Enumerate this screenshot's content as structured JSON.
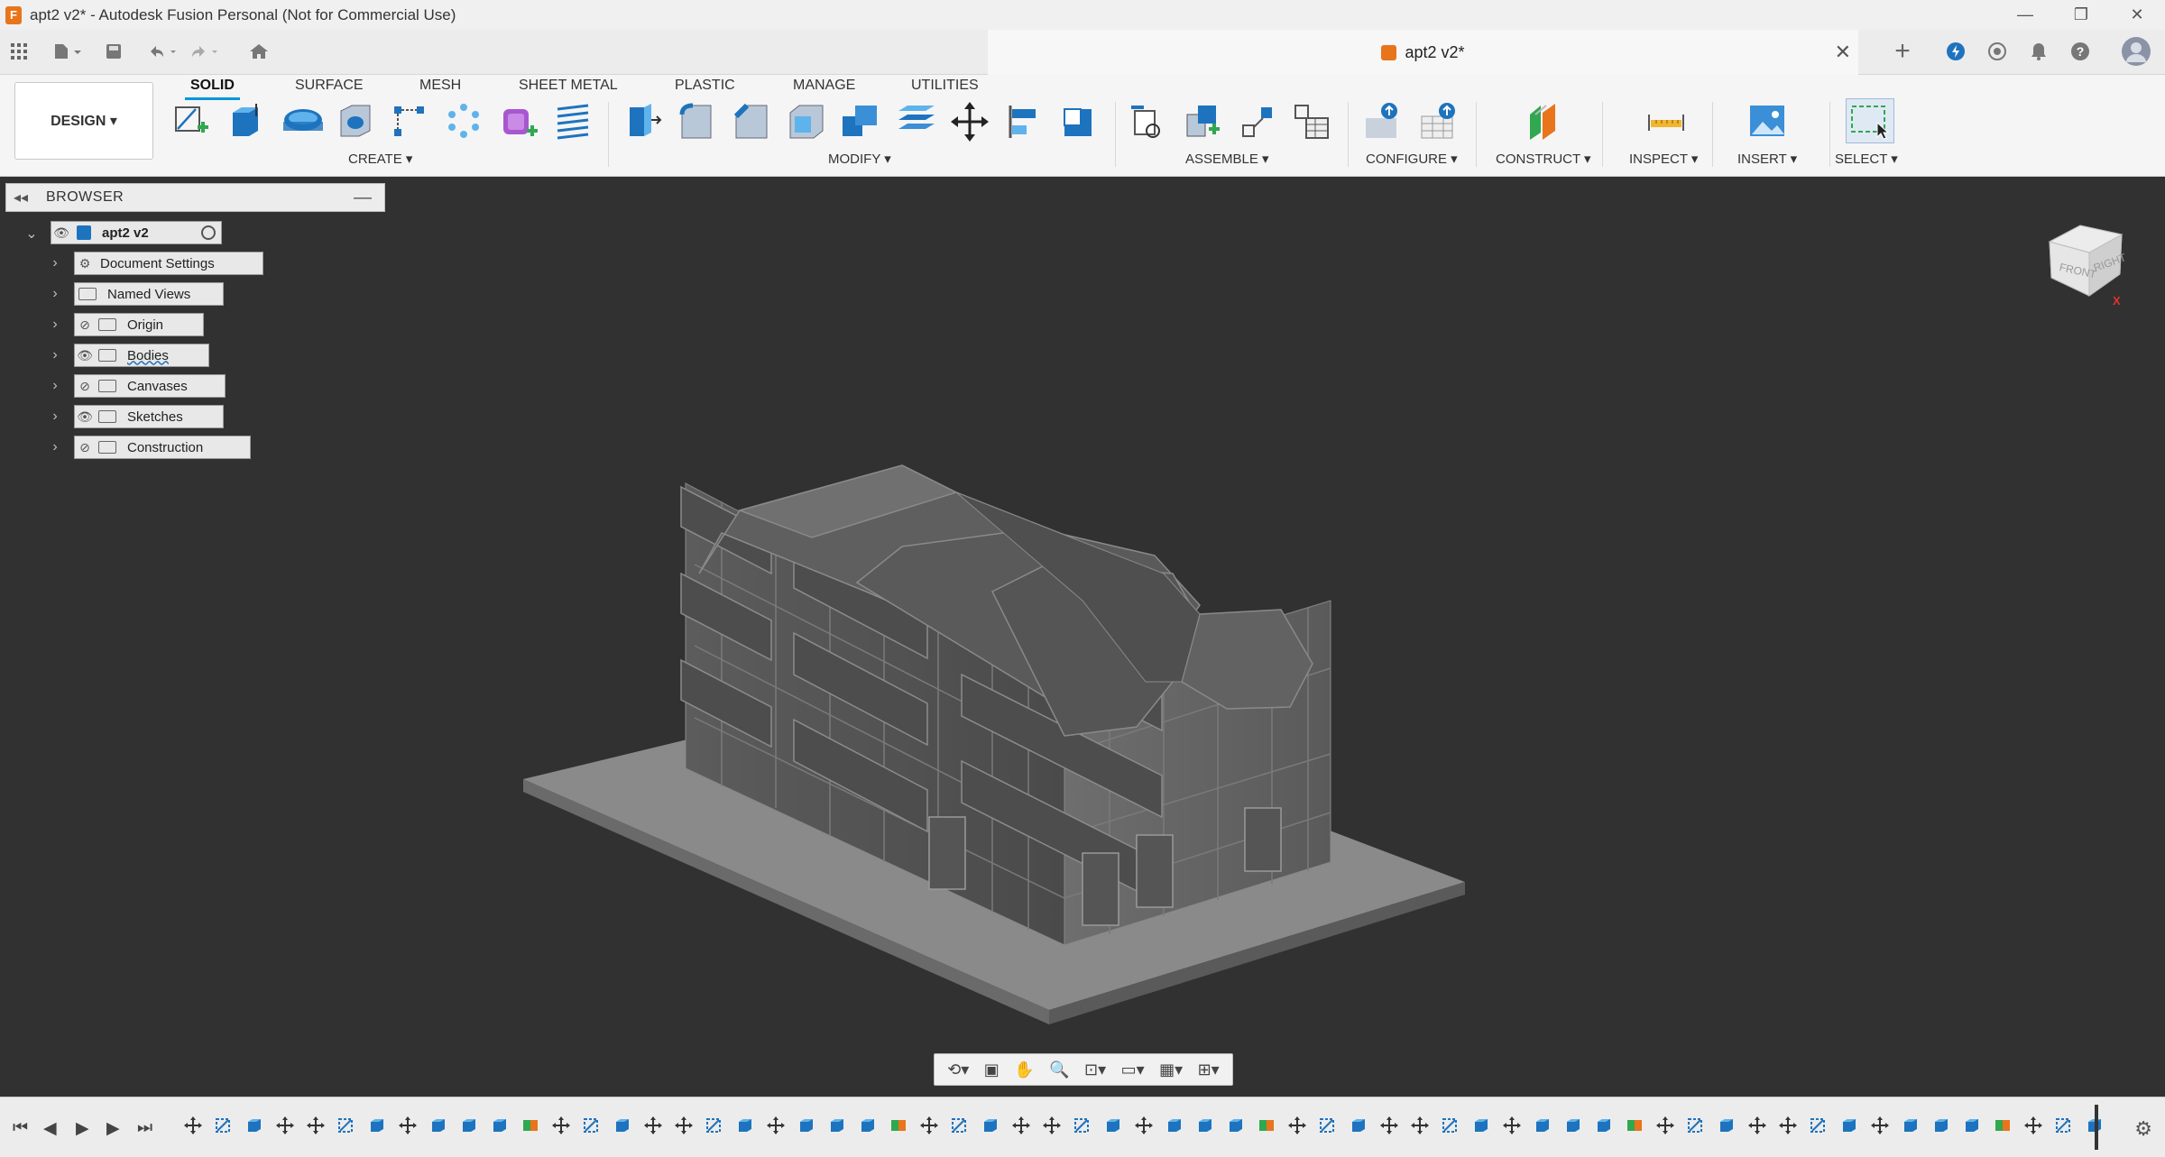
{
  "window": {
    "title": "apt2 v2* - Autodesk Fusion Personal (Not for Commercial Use)",
    "app_icon_letter": "F",
    "controls": {
      "minimize": "—",
      "restore": "❐",
      "close": "✕"
    }
  },
  "tabbar": {
    "document_tab": "apt2 v2*",
    "close_glyph": "✕",
    "new_tab_glyph": "+",
    "icons": [
      "apps-grid-icon",
      "file-icon",
      "save-icon",
      "undo-icon",
      "redo-icon",
      "home-icon",
      "extensions-icon",
      "job-status-icon",
      "notifications-icon",
      "help-icon",
      "user-avatar-icon"
    ]
  },
  "ribbon": {
    "workspace_button": "DESIGN ▾",
    "tabs": [
      {
        "label": "SOLID",
        "active": true
      },
      {
        "label": "SURFACE",
        "active": false
      },
      {
        "label": "MESH",
        "active": false
      },
      {
        "label": "SHEET METAL",
        "active": false
      },
      {
        "label": "PLASTIC",
        "active": false
      },
      {
        "label": "MANAGE",
        "active": false
      },
      {
        "label": "UTILITIES",
        "active": false
      }
    ],
    "groups": [
      {
        "label": "CREATE ▾"
      },
      {
        "label": "MODIFY ▾"
      },
      {
        "label": "ASSEMBLE ▾"
      },
      {
        "label": "CONFIGURE ▾"
      },
      {
        "label": "CONSTRUCT ▾"
      },
      {
        "label": "INSPECT ▾"
      },
      {
        "label": "INSERT ▾"
      },
      {
        "label": "SELECT ▾"
      }
    ],
    "accent_color": "#0696d7"
  },
  "browser": {
    "title": "BROWSER",
    "root": "apt2 v2",
    "items": [
      {
        "label": "Document Settings",
        "icon": "gear-icon"
      },
      {
        "label": "Named Views",
        "icon": "folder-icon"
      },
      {
        "label": "Origin",
        "icon": "folder-icon",
        "visibility": "hidden"
      },
      {
        "label": "Bodies",
        "icon": "folder-icon",
        "visibility": "visible"
      },
      {
        "label": "Canvases",
        "icon": "folder-icon",
        "visibility": "hidden"
      },
      {
        "label": "Sketches",
        "icon": "folder-icon",
        "visibility": "visible"
      },
      {
        "label": "Construction",
        "icon": "folder-icon",
        "visibility": "hidden"
      }
    ]
  },
  "viewcube": {
    "front": "FRONT",
    "right": "RIGHT",
    "z_axis": "Z",
    "x_axis": "X"
  },
  "navbar": {
    "icons": [
      "orbit-icon",
      "look-at-icon",
      "pan-icon",
      "zoom-icon",
      "fit-icon",
      "display-settings-icon",
      "grid-icon",
      "viewports-icon"
    ]
  },
  "timeline": {
    "controls": [
      "⏮",
      "◀",
      "▶",
      "▶",
      "⏭"
    ],
    "settings_glyph": "⚙"
  }
}
